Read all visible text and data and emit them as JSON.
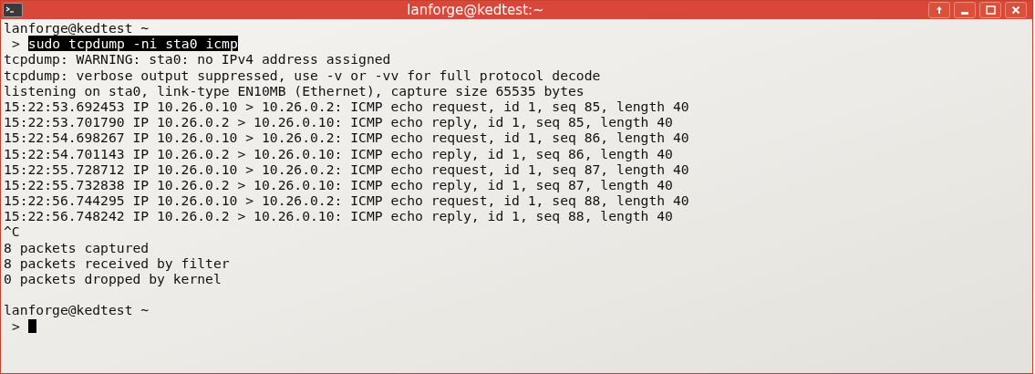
{
  "window": {
    "title": "lanforge@kedtest:~"
  },
  "lines": [
    {
      "kind": "output",
      "text": "lanforge@kedtest ~"
    },
    {
      "kind": "command",
      "prompt": ">",
      "text": "sudo tcpdump -ni sta0 icmp"
    },
    {
      "kind": "output",
      "text": "tcpdump: WARNING: sta0: no IPv4 address assigned"
    },
    {
      "kind": "output",
      "text": "tcpdump: verbose output suppressed, use -v or -vv for full protocol decode"
    },
    {
      "kind": "output",
      "text": "listening on sta0, link-type EN10MB (Ethernet), capture size 65535 bytes"
    },
    {
      "kind": "output",
      "text": "15:22:53.692453 IP 10.26.0.10 > 10.26.0.2: ICMP echo request, id 1, seq 85, length 40"
    },
    {
      "kind": "output",
      "text": "15:22:53.701790 IP 10.26.0.2 > 10.26.0.10: ICMP echo reply, id 1, seq 85, length 40"
    },
    {
      "kind": "output",
      "text": "15:22:54.698267 IP 10.26.0.10 > 10.26.0.2: ICMP echo request, id 1, seq 86, length 40"
    },
    {
      "kind": "output",
      "text": "15:22:54.701143 IP 10.26.0.2 > 10.26.0.10: ICMP echo reply, id 1, seq 86, length 40"
    },
    {
      "kind": "output",
      "text": "15:22:55.728712 IP 10.26.0.10 > 10.26.0.2: ICMP echo request, id 1, seq 87, length 40"
    },
    {
      "kind": "output",
      "text": "15:22:55.732838 IP 10.26.0.2 > 10.26.0.10: ICMP echo reply, id 1, seq 87, length 40"
    },
    {
      "kind": "output",
      "text": "15:22:56.744295 IP 10.26.0.10 > 10.26.0.2: ICMP echo request, id 1, seq 88, length 40"
    },
    {
      "kind": "output",
      "text": "15:22:56.748242 IP 10.26.0.2 > 10.26.0.10: ICMP echo reply, id 1, seq 88, length 40"
    },
    {
      "kind": "output",
      "text": "^C"
    },
    {
      "kind": "output",
      "text": "8 packets captured"
    },
    {
      "kind": "output",
      "text": "8 packets received by filter"
    },
    {
      "kind": "output",
      "text": "0 packets dropped by kernel"
    },
    {
      "kind": "blank"
    },
    {
      "kind": "output",
      "text": "lanforge@kedtest ~"
    },
    {
      "kind": "cursor",
      "prompt": ">"
    }
  ]
}
